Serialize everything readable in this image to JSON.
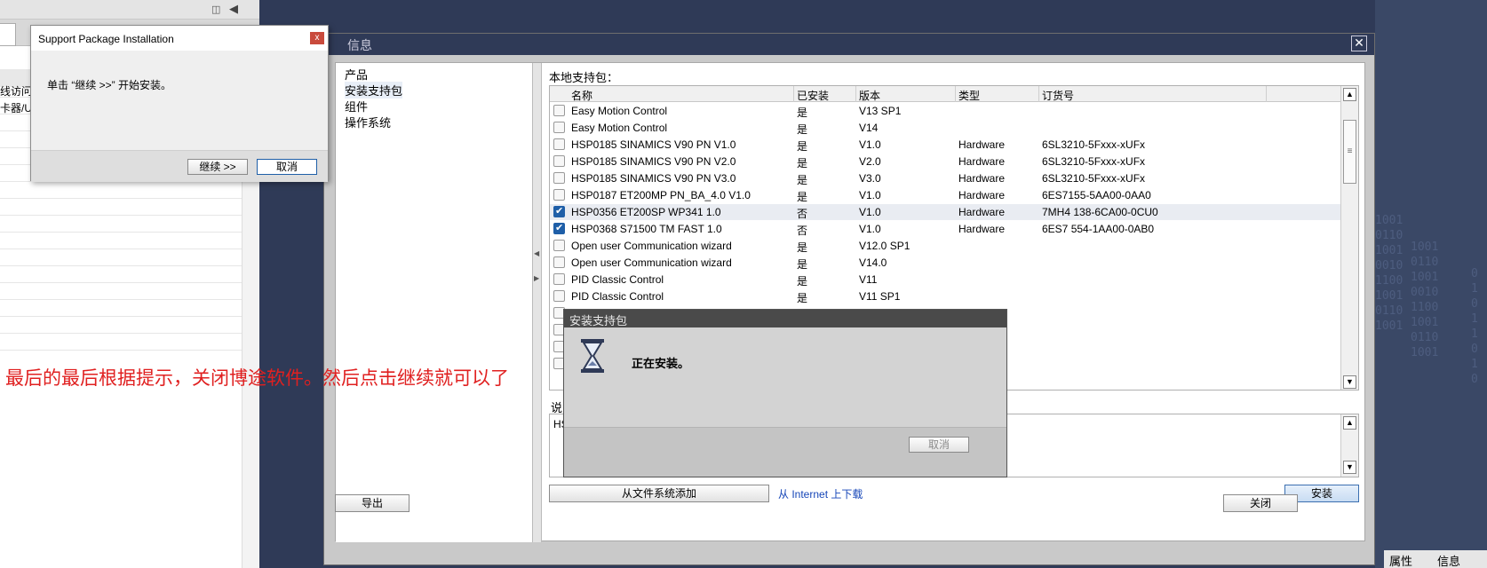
{
  "background": {
    "left_panel_rows": [
      "线访问",
      "卡器/US"
    ],
    "right_panel_texts": [
      "1001\n0110\n1001\n0010\n1100\n1001\n0110\n1001",
      "1001\n0110\n1001\n0010\n1100\n1001\n0110\n1001",
      "0\n1\n0\n1\n1\n0\n1\n0"
    ],
    "bottom_right_tabs": [
      "属性",
      "信息"
    ]
  },
  "main_dialog": {
    "title": "信息",
    "close_icon": "close-icon",
    "nav": [
      "产品",
      "安装支持包",
      "组件",
      "操作系统"
    ],
    "nav_selected": 1,
    "package_label": "本地支持包：",
    "columns": [
      "名称",
      "已安装",
      "版本",
      "类型",
      "订货号"
    ],
    "rows": [
      {
        "checked": false,
        "name": "Easy Motion Control",
        "installed": "是",
        "version": "V13 SP1",
        "type": "",
        "order": ""
      },
      {
        "checked": false,
        "name": "Easy Motion Control",
        "installed": "是",
        "version": "V14",
        "type": "",
        "order": ""
      },
      {
        "checked": false,
        "name": "HSP0185 SINAMICS V90 PN V1.0",
        "installed": "是",
        "version": "V1.0",
        "type": "Hardware",
        "order": "6SL3210-5Fxxx-xUFx"
      },
      {
        "checked": false,
        "name": "HSP0185 SINAMICS V90 PN V2.0",
        "installed": "是",
        "version": "V2.0",
        "type": "Hardware",
        "order": "6SL3210-5Fxxx-xUFx"
      },
      {
        "checked": false,
        "name": "HSP0185 SINAMICS V90 PN V3.0",
        "installed": "是",
        "version": "V3.0",
        "type": "Hardware",
        "order": "6SL3210-5Fxxx-xUFx"
      },
      {
        "checked": false,
        "name": "HSP0187 ET200MP PN_BA_4.0 V1.0",
        "installed": "是",
        "version": "V1.0",
        "type": "Hardware",
        "order": "6ES7155-5AA00-0AA0"
      },
      {
        "checked": true,
        "name": "HSP0356 ET200SP WP341 1.0",
        "installed": "否",
        "version": "V1.0",
        "type": "Hardware",
        "order": "7MH4 138-6CA00-0CU0"
      },
      {
        "checked": true,
        "name": "HSP0368 S71500 TM FAST 1.0",
        "installed": "否",
        "version": "V1.0",
        "type": "Hardware",
        "order": "6ES7 554-1AA00-0AB0"
      },
      {
        "checked": false,
        "name": "Open user Communication wizard",
        "installed": "是",
        "version": "V12.0 SP1",
        "type": "",
        "order": ""
      },
      {
        "checked": false,
        "name": "Open user Communication wizard",
        "installed": "是",
        "version": "V14.0",
        "type": "",
        "order": ""
      },
      {
        "checked": false,
        "name": "PID Classic Control",
        "installed": "是",
        "version": "V11",
        "type": "",
        "order": ""
      },
      {
        "checked": false,
        "name": "PID Classic Control",
        "installed": "是",
        "version": "V11 SP1",
        "type": "",
        "order": ""
      }
    ],
    "highlight_row": 6,
    "desc_label": "说明",
    "desc_text": "HSP",
    "add_from_fs": "从文件系统添加",
    "download_link": "从 Internet 上下载",
    "install_button": "安装",
    "export_button": "导出",
    "close_button": "关闭"
  },
  "support_dialog": {
    "title": "Support Package Installation",
    "close_glyph": "x",
    "message": "单击 “继续 >>” 开始安装。",
    "continue_button": "继续 >>",
    "cancel_button": "取消"
  },
  "installing_dialog": {
    "title": "安装支持包",
    "message": "正在安装。",
    "icon": "hourglass-icon",
    "cancel_button": "取消"
  },
  "annotation": "最后的最后根据提示，关闭博途软件。然后点击继续就可以了"
}
